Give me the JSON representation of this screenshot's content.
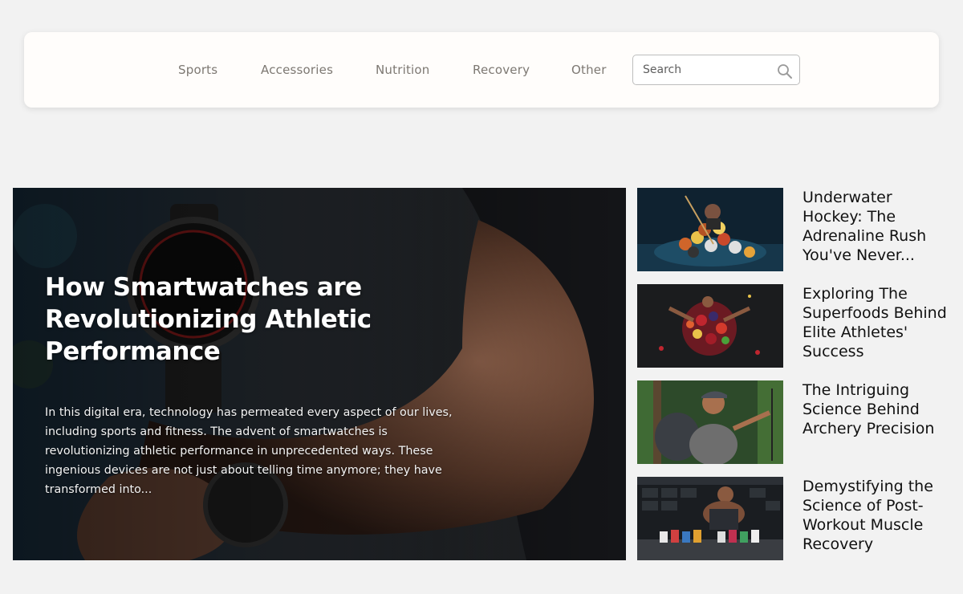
{
  "nav": {
    "items": [
      {
        "label": "Sports"
      },
      {
        "label": "Accessories"
      },
      {
        "label": "Nutrition"
      },
      {
        "label": "Recovery"
      },
      {
        "label": "Other"
      }
    ],
    "search": {
      "placeholder": "Search",
      "value": ""
    }
  },
  "hero": {
    "title": "How Smartwatches are Revolutionizing Athletic Performance",
    "excerpt": "In this digital era, technology has permeated every aspect of our lives, including sports and fitness. The advent of smartwatches is revolutionizing athletic performance in unprecedented ways. These ingenious devices are not just about telling time anymore; they have transformed into..."
  },
  "side_articles": [
    {
      "title": "Underwater Hockey: The Adrenaline Rush You've Never..."
    },
    {
      "title": "Exploring The Superfoods Behind Elite Athletes' Success"
    },
    {
      "title": "The Intriguing Science Behind Archery Precision"
    },
    {
      "title": "Demystifying the Science of Post-Workout Muscle Recovery"
    }
  ],
  "colors": {
    "page_bg": "#f2f2f2",
    "nav_bg": "#fffdfb",
    "nav_text": "#7d7872",
    "title_text": "#111111",
    "hero_text": "#ffffff"
  }
}
